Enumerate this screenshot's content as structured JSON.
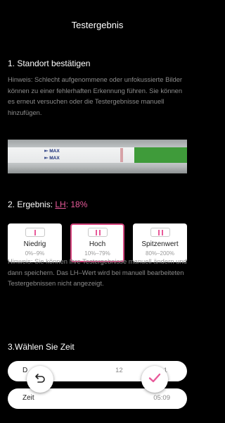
{
  "header": {
    "title": "Testergebnis"
  },
  "section1": {
    "heading": "1. Standort bestätigen",
    "hint": "Hinweis: Schlecht aufgenommene oder unfokussierte Bilder können zu einer fehlerhaften Erkennung führen. Sie können es erneut versuchen oder die Testergebnisse manuell hinzufügen.",
    "strip_text": [
      "MAX",
      "MAX"
    ]
  },
  "section2": {
    "heading_prefix": "2. Ergebnis: ",
    "lh_label": "LH",
    "value": ": 18%",
    "cards": [
      {
        "name": "Niedrig",
        "range": "0%–9%"
      },
      {
        "name": "Hoch",
        "range": "10%–79%"
      },
      {
        "name": "Spitzenwert",
        "range": "80%–200%"
      }
    ],
    "selected_card": "Hoch",
    "hint": "Hinweis: Sie können Ihre Testergebnisse manuell ändern und dann speichern. Das LH–Wert wird bei manuell bearbeiteten Testergebnissen nicht angezeigt."
  },
  "section3": {
    "heading": "3.Wählen Sie Zeit",
    "date_label": "D",
    "date_value": "12",
    "date_value_tail": "1",
    "time_label": "Zeit",
    "time_value": "05:09"
  },
  "colors": {
    "accent": "#e85a9a",
    "selected_border": "#d6467f",
    "background": "#000000"
  },
  "icons": {
    "undo": "undo-arrow-icon",
    "confirm": "checkmark-icon"
  }
}
